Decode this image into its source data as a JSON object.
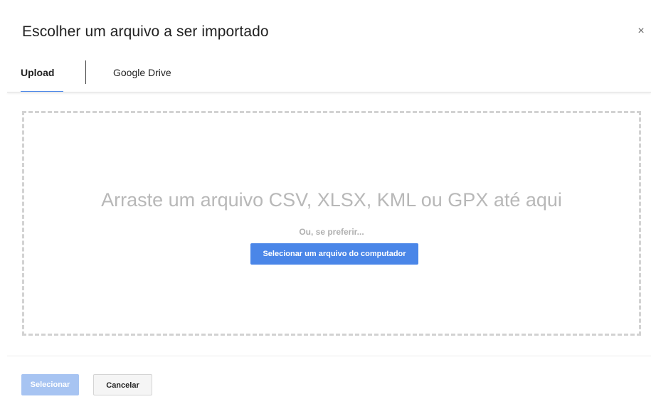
{
  "dialog": {
    "title": "Escolher um arquivo a ser importado",
    "close_icon": "×"
  },
  "tabs": [
    {
      "label": "Upload",
      "active": true
    },
    {
      "label": "Google Drive",
      "active": false
    }
  ],
  "dropzone": {
    "prompt": "Arraste um arquivo CSV, XLSX, KML ou GPX até aqui",
    "alt_text": "Ou, se preferir...",
    "button_label": "Selecionar um arquivo do computador"
  },
  "footer": {
    "select_label": "Selecionar",
    "select_enabled": false,
    "cancel_label": "Cancelar"
  },
  "colors": {
    "accent": "#4a86e8",
    "accent_disabled": "#a7c4f2",
    "dashed_border": "#d2d2d2"
  }
}
